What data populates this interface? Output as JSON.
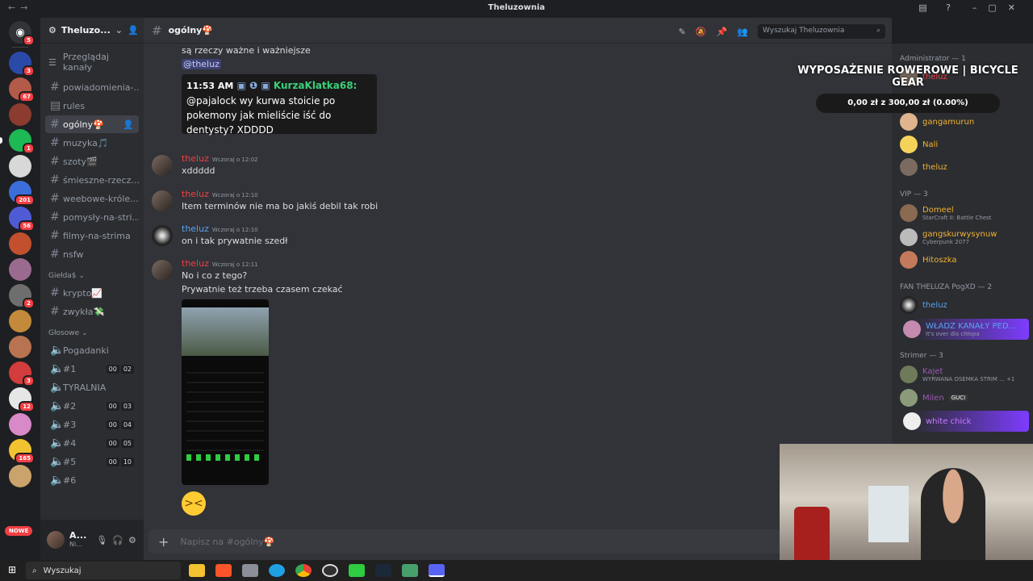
{
  "window": {
    "title": "Theluzownia"
  },
  "guild": {
    "name": "Theluzo...",
    "browse_label": "Przeglądaj kanały"
  },
  "server_badges": [
    "5",
    "3",
    "67",
    "",
    "1",
    "",
    "201",
    "56",
    "",
    "",
    "2",
    "",
    "",
    "3",
    "12",
    "",
    "165",
    ""
  ],
  "nowe_label": "NOWE",
  "channels": [
    {
      "name": "powiadomienia-...",
      "type": "text",
      "state": "normal"
    },
    {
      "name": "rules",
      "type": "text",
      "state": "normal"
    },
    {
      "name": "ogólny🍄",
      "type": "text",
      "state": "active"
    },
    {
      "name": "muzyka🎵",
      "type": "text",
      "state": "normal"
    },
    {
      "name": "szoty🎬",
      "type": "text",
      "state": "normal"
    },
    {
      "name": "śmieszne-rzecz...",
      "type": "text",
      "state": "normal"
    },
    {
      "name": "weebowe-króle...",
      "type": "text",
      "state": "normal"
    },
    {
      "name": "pomysły-na-stri...",
      "type": "text",
      "state": "normal"
    },
    {
      "name": "filmy-na-strima",
      "type": "text",
      "state": "normal"
    },
    {
      "name": "nsfw",
      "type": "text",
      "state": "normal"
    }
  ],
  "category_gielda": "Giełda$",
  "gielda_channels": [
    {
      "name": "krypto📈"
    },
    {
      "name": "zwykła💸"
    }
  ],
  "category_voice": "Głosowe",
  "voice_channels": [
    {
      "name": "Pogadanki",
      "c1": "",
      "c2": ""
    },
    {
      "name": "#1",
      "c1": "00",
      "c2": "02"
    },
    {
      "name": "TYRALNIA",
      "c1": "",
      "c2": ""
    },
    {
      "name": "#2",
      "c1": "00",
      "c2": "03"
    },
    {
      "name": "#3",
      "c1": "00",
      "c2": "04"
    },
    {
      "name": "#4",
      "c1": "00",
      "c2": "05"
    },
    {
      "name": "#5",
      "c1": "00",
      "c2": "10"
    },
    {
      "name": "#6",
      "c1": "",
      "c2": ""
    }
  ],
  "user_panel": {
    "name": "A...",
    "status": "Ni..."
  },
  "channel_header": {
    "name": "ogólny🍄",
    "search_placeholder": "Wyszukaj Theluzownia"
  },
  "messages": {
    "top_text": "są rzeczy ważne i ważniejsze",
    "top_mention": "@theluz",
    "embed_time": "11:53 AM",
    "embed_nick": "KurzaKlatka68:",
    "embed_text": "@pajalock wy kurwa stoicie po pokemony jak mieliście iść do dentysty? XDDDD",
    "m1": {
      "user": "theluz",
      "time": "Wczoraj o 12:02",
      "text": "xddddd"
    },
    "m2": {
      "user": "theluz",
      "time": "Wczoraj o 12:10",
      "text": "Item terminów nie ma bo jakiś debil tak robi"
    },
    "m3": {
      "user": "theluz",
      "time": "Wczoraj o 12:10",
      "text": "on i tak prywatnie szedł"
    },
    "m4": {
      "user": "theluz",
      "time": "Wczoraj o 12:11",
      "text1": "No i co z tego?",
      "text2": "Prywatnie też trzeba czasem czekać"
    }
  },
  "composer_placeholder": "Napisz na #ogólny🍄",
  "members": {
    "admin_role": "Administrator — 1",
    "admin_member": "theluz",
    "mod_members": [
      "gangamurun",
      "Nali",
      "theluz"
    ],
    "vip_role": "VIP — 3",
    "vip_members": [
      {
        "name": "Domeel",
        "status": "StarCraft II: Battle Chest"
      },
      {
        "name": "gangskurwysynuw",
        "status": "Cyberpunk 2077"
      },
      {
        "name": "Hitoszka",
        "status": ""
      }
    ],
    "fan_role": "FAN THELUZA PogXD — 2",
    "fan_members": [
      {
        "name": "theluz",
        "status": ""
      },
      {
        "name": "WŁADZ KANAŁY PED...",
        "status": "It's over dla chłopa"
      }
    ],
    "strimer_role": "Strimer — 3",
    "strimer_members": [
      {
        "name": "Kajet",
        "status": "WYRWANA OSEMKA STRIM ... +1"
      },
      {
        "name": "Milen",
        "status": "GUCI"
      },
      {
        "name": "white chick",
        "status": ""
      }
    ]
  },
  "overlay": {
    "headline": "WYPOSAŻENIE ROWEROWE | BICYCLE GEAR",
    "progress_text": "0,00 zł z 300,00 zł (0.00%)"
  },
  "taskbar": {
    "search_label": "Wyszukaj"
  },
  "colors": {
    "accent": "#5865f2",
    "red_user": "#f23f43",
    "blue_user": "#5aa3f0"
  }
}
